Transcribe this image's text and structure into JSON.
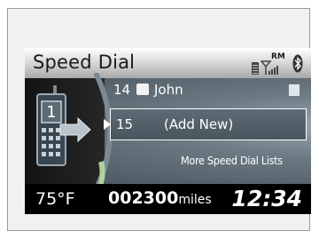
{
  "header": {
    "title": "Speed Dial",
    "roaming_label": "RM",
    "icons": [
      "phone-battery-icon",
      "signal-strength-icon",
      "bluetooth-icon"
    ]
  },
  "speed_dial": {
    "rows": [
      {
        "number": "14",
        "name": "John",
        "icon": "contact-icon",
        "trailing_icon": "phonebook-icon"
      }
    ],
    "add_new": {
      "number": "15",
      "label": "(Add New)",
      "selected": true
    },
    "more_lists": "More Speed Dial Lists"
  },
  "footer": {
    "temperature": "75°F",
    "odometer_value": "002300",
    "odometer_unit": "miles",
    "clock": "12:34"
  },
  "colors": {
    "header_bg": "#d2d2d2",
    "screen_bg": "#000000",
    "list_bg": "#6b7983",
    "text": "#ffffff"
  }
}
